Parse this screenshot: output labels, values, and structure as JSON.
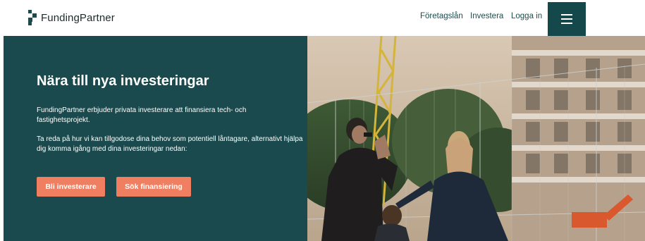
{
  "brand": {
    "name": "FundingPartner"
  },
  "nav": {
    "items": [
      {
        "label": "Företagslån"
      },
      {
        "label": "Investera"
      },
      {
        "label": "Logga in"
      }
    ],
    "menu_icon": "hamburger-menu-icon"
  },
  "hero": {
    "title": "Nära till nya investeringar",
    "paragraph1": "FundingPartner erbjuder privata investerare att finansiera tech- och fastighetsprojekt.",
    "paragraph2": "Ta reda på hur vi kan tillgodose dina behov som potentiell låntagare, alternativt hjälpa dig komma igång med dina investeringar nedan:",
    "buttons": [
      {
        "label": "Bli investerare"
      },
      {
        "label": "Sök finansiering"
      }
    ]
  },
  "colors": {
    "brand_dark": "#1a4a4d",
    "accent": "#f07f62",
    "menu_bg": "#14484a"
  }
}
